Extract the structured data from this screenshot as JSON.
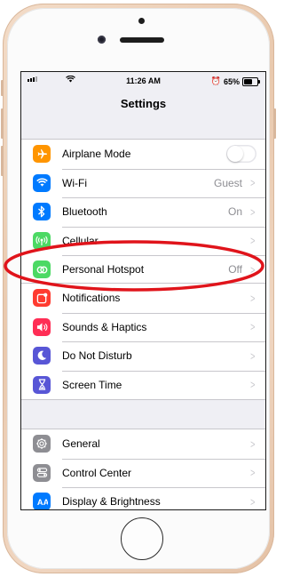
{
  "status_bar": {
    "time": "11:26 AM",
    "battery": "65%",
    "battery_level": 0.65
  },
  "nav": {
    "title": "Settings"
  },
  "groups": [
    {
      "rows": [
        {
          "label": "Airplane Mode",
          "value": "",
          "icon": "airplane-icon",
          "color": "#ff9500",
          "accessory": "toggle",
          "toggle_on": false
        },
        {
          "label": "Wi-Fi",
          "value": "Guest",
          "icon": "wifi-icon",
          "color": "#007aff",
          "accessory": "chevron"
        },
        {
          "label": "Bluetooth",
          "value": "On",
          "icon": "bluetooth-icon",
          "color": "#007aff",
          "accessory": "chevron"
        },
        {
          "label": "Cellular",
          "value": "",
          "icon": "cellular-icon",
          "color": "#4cd964",
          "accessory": "chevron"
        },
        {
          "label": "Personal Hotspot",
          "value": "Off",
          "icon": "hotspot-icon",
          "color": "#4cd964",
          "accessory": "chevron"
        }
      ]
    },
    {
      "rows": [
        {
          "label": "Notifications",
          "value": "",
          "icon": "notifications-icon",
          "color": "#ff3b30",
          "accessory": "chevron"
        },
        {
          "label": "Sounds & Haptics",
          "value": "",
          "icon": "sounds-icon",
          "color": "#ff2d55",
          "accessory": "chevron"
        },
        {
          "label": "Do Not Disturb",
          "value": "",
          "icon": "moon-icon",
          "color": "#5856d6",
          "accessory": "chevron"
        },
        {
          "label": "Screen Time",
          "value": "",
          "icon": "hourglass-icon",
          "color": "#5856d6",
          "accessory": "chevron"
        }
      ]
    },
    {
      "rows": [
        {
          "label": "General",
          "value": "",
          "icon": "gear-icon",
          "color": "#8e8e93",
          "accessory": "chevron"
        },
        {
          "label": "Control Center",
          "value": "",
          "icon": "control-center-icon",
          "color": "#8e8e93",
          "accessory": "chevron"
        },
        {
          "label": "Display & Brightness",
          "value": "",
          "icon": "display-icon",
          "color": "#007aff",
          "accessory": "chevron"
        }
      ]
    }
  ],
  "chevron_glyph": ">",
  "highlight": {
    "target": "Personal Hotspot",
    "color": "#e0141b"
  }
}
